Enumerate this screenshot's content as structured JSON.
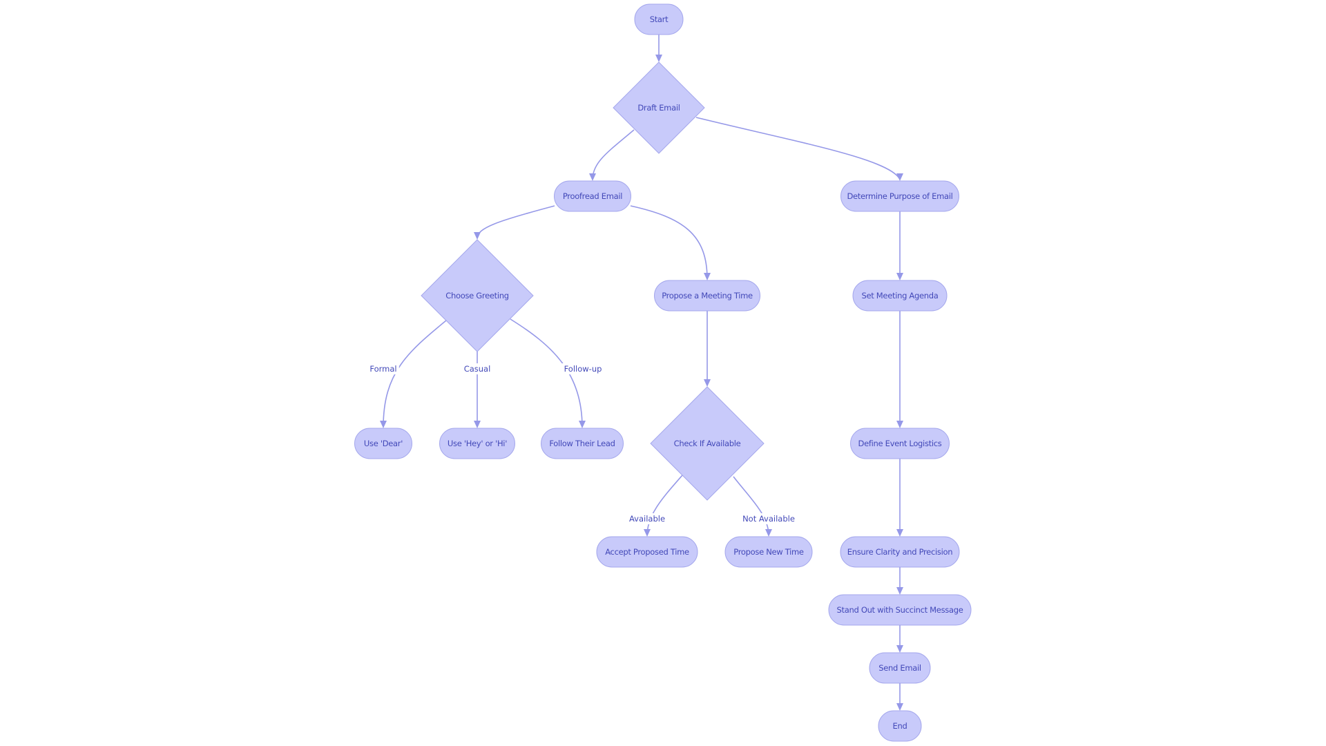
{
  "diagram": {
    "type": "flowchart",
    "colors": {
      "node_fill": "#c8cafa",
      "node_stroke": "#a4a7ec",
      "text": "#4248b8",
      "edge": "#9598e8"
    },
    "nodes": [
      {
        "id": "start",
        "label": "Start",
        "shape": "stadium"
      },
      {
        "id": "draft",
        "label": "Draft Email",
        "shape": "diamond"
      },
      {
        "id": "proofread",
        "label": "Proofread Email",
        "shape": "stadium"
      },
      {
        "id": "purpose",
        "label": "Determine Purpose of Email",
        "shape": "stadium"
      },
      {
        "id": "greeting",
        "label": "Choose Greeting",
        "shape": "diamond"
      },
      {
        "id": "propose",
        "label": "Propose a Meeting Time",
        "shape": "stadium"
      },
      {
        "id": "agenda",
        "label": "Set Meeting Agenda",
        "shape": "stadium"
      },
      {
        "id": "dear",
        "label": "Use 'Dear'",
        "shape": "stadium"
      },
      {
        "id": "heyhi",
        "label": "Use 'Hey' or 'Hi'",
        "shape": "stadium"
      },
      {
        "id": "lead",
        "label": "Follow Their Lead",
        "shape": "stadium"
      },
      {
        "id": "check",
        "label": "Check If Available",
        "shape": "diamond"
      },
      {
        "id": "logistics",
        "label": "Define Event Logistics",
        "shape": "stadium"
      },
      {
        "id": "accept",
        "label": "Accept Proposed Time",
        "shape": "stadium"
      },
      {
        "id": "newtime",
        "label": "Propose New Time",
        "shape": "stadium"
      },
      {
        "id": "clarity",
        "label": "Ensure Clarity and Precision",
        "shape": "stadium"
      },
      {
        "id": "standout",
        "label": "Stand Out with Succinct Message",
        "shape": "stadium"
      },
      {
        "id": "send",
        "label": "Send Email",
        "shape": "stadium"
      },
      {
        "id": "end",
        "label": "End",
        "shape": "stadium"
      }
    ],
    "edges": [
      {
        "from": "start",
        "to": "draft",
        "label": ""
      },
      {
        "from": "draft",
        "to": "proofread",
        "label": ""
      },
      {
        "from": "draft",
        "to": "purpose",
        "label": ""
      },
      {
        "from": "proofread",
        "to": "greeting",
        "label": ""
      },
      {
        "from": "proofread",
        "to": "propose",
        "label": ""
      },
      {
        "from": "greeting",
        "to": "dear",
        "label": "Formal"
      },
      {
        "from": "greeting",
        "to": "heyhi",
        "label": "Casual"
      },
      {
        "from": "greeting",
        "to": "lead",
        "label": "Follow-up"
      },
      {
        "from": "propose",
        "to": "check",
        "label": ""
      },
      {
        "from": "check",
        "to": "accept",
        "label": "Available"
      },
      {
        "from": "check",
        "to": "newtime",
        "label": "Not Available"
      },
      {
        "from": "purpose",
        "to": "agenda",
        "label": ""
      },
      {
        "from": "agenda",
        "to": "logistics",
        "label": ""
      },
      {
        "from": "logistics",
        "to": "clarity",
        "label": ""
      },
      {
        "from": "clarity",
        "to": "standout",
        "label": ""
      },
      {
        "from": "standout",
        "to": "send",
        "label": ""
      },
      {
        "from": "send",
        "to": "end",
        "label": ""
      }
    ]
  }
}
